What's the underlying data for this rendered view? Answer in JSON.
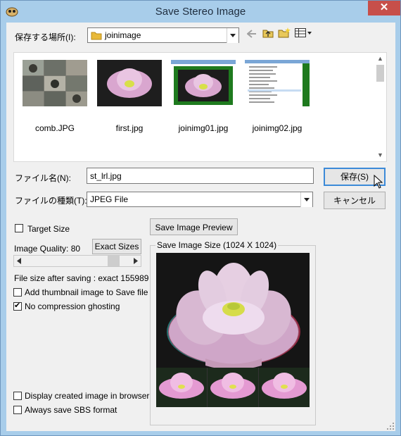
{
  "window": {
    "title": "Save Stereo Image",
    "close_symbol": "✕"
  },
  "location": {
    "label": "保存する場所(I):",
    "folder": "joinimage"
  },
  "files": [
    {
      "name": "comb.JPG"
    },
    {
      "name": "first.jpg"
    },
    {
      "name": "joinimg01.jpg"
    },
    {
      "name": "joinimg02.jpg"
    }
  ],
  "filename": {
    "label": "ファイル名(N):",
    "value": "st_lrl.jpg"
  },
  "filetype": {
    "label": "ファイルの種類(T):",
    "value": "JPEG File"
  },
  "buttons": {
    "save": "保存(S)",
    "cancel": "キャンセル",
    "preview": "Save Image Preview",
    "exact_sizes": "Exact Sizes"
  },
  "options": {
    "target_size": {
      "label": "Target Size",
      "checked": false
    },
    "image_quality_label": "Image Quality: 80",
    "image_quality": 80,
    "file_size_text": "File size after saving : exact 155989",
    "add_thumbnail": {
      "label": "Add thumbnail image to Save file",
      "checked": false
    },
    "no_compression": {
      "label": "No compression ghosting",
      "checked": true
    },
    "display_browser": {
      "label": "Display created image in browser",
      "checked": false
    },
    "always_sbs": {
      "label": "Always save SBS format",
      "checked": false
    }
  },
  "preview_group": {
    "title": "Save Image Size (1024 X 1024)"
  },
  "colors": {
    "titlebar": "#a8cdea",
    "close": "#c74f4a",
    "focus": "#3c8ad8",
    "lotus": "#e8a6d6"
  }
}
